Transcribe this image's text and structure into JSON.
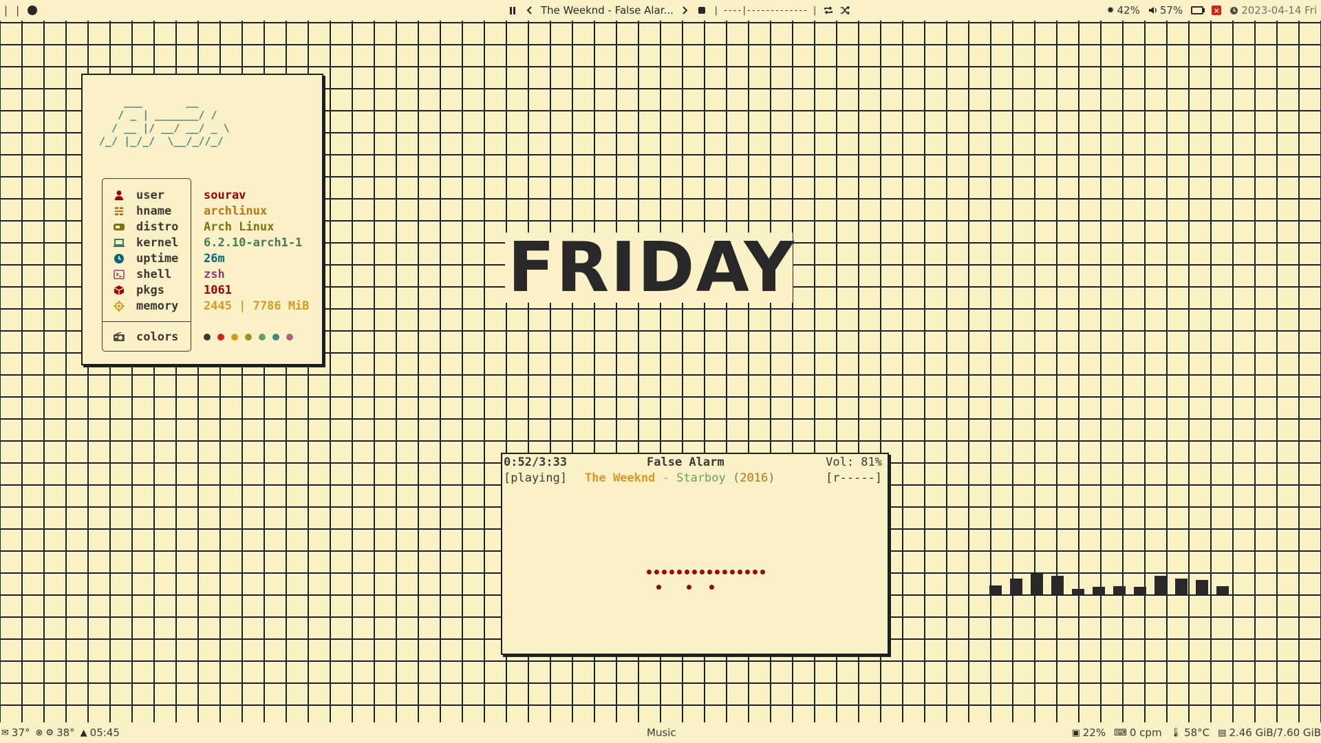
{
  "topbar": {
    "left": {
      "separator": "|"
    },
    "media": {
      "title": "The Weeknd - False Alar...",
      "progress": "| ----|------------- |"
    },
    "status": {
      "brightness": "42%",
      "volume": "57%",
      "close_label": "×",
      "clock": "2023-04-14 Fri"
    }
  },
  "fetch": {
    "ascii": "    ___       __\n   / _ | _______/ /\n  / __ |/ __/ __/ _ \\\n/_/ |_/_/  \\__/_//_/",
    "rows": [
      {
        "key": "user",
        "value": "sourav",
        "color": "#9d0006"
      },
      {
        "key": "hname",
        "value": "archlinux",
        "color": "#b57614"
      },
      {
        "key": "distro",
        "value": "Arch Linux",
        "color": "#79740e"
      },
      {
        "key": "kernel",
        "value": "6.2.10-arch1-1",
        "color": "#427b58"
      },
      {
        "key": "uptime",
        "value": "26m",
        "color": "#076678"
      },
      {
        "key": "shell",
        "value": "zsh",
        "color": "#8f3f71"
      },
      {
        "key": "pkgs",
        "value": "1061",
        "color": "#9d0006"
      },
      {
        "key": "memory",
        "value": "2445 | 7786 MiB",
        "color": "#d79921"
      }
    ],
    "colors_label": "colors",
    "palette": [
      "#3c3836",
      "#cc241d",
      "#d79921",
      "#98971a",
      "#689d6a",
      "#458588",
      "#b16286"
    ]
  },
  "clock_word": "FRIDAY",
  "music": {
    "time": "0:52/3:33",
    "title": "False Alarm",
    "volume": "Vol: 81%",
    "state": "[playing]",
    "artist": "The Weeknd",
    "dash": "-",
    "album": "Starboy",
    "year": "2016",
    "paren_open": "(",
    "paren_close": ")",
    "flags": "[r-----]"
  },
  "visualizer": {
    "levels": [
      0.35,
      0.6,
      0.8,
      0.7,
      0.2,
      0.28,
      0.32,
      0.3,
      0.72,
      0.6,
      0.55,
      0.32
    ]
  },
  "bottombar": {
    "temp1": "37°",
    "temp2": "38°",
    "time": "05:45",
    "center": "Music",
    "cpu": "22%",
    "keys": "0 cpm",
    "temp3": "58°C",
    "mem": "2.46 GiB/7.60 GiB"
  }
}
